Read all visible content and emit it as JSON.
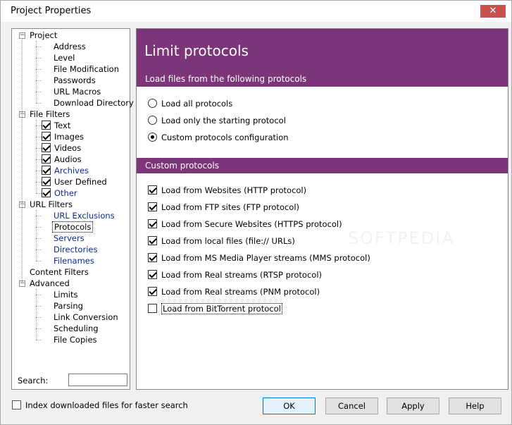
{
  "window": {
    "title": "Project Properties",
    "close_glyph": "✕"
  },
  "tree": {
    "items": [
      {
        "label": "Project",
        "level": 0,
        "expander": "−"
      },
      {
        "label": "Address",
        "level": 1
      },
      {
        "label": "Level",
        "level": 1
      },
      {
        "label": "File Modification",
        "level": 1
      },
      {
        "label": "Passwords",
        "level": 1
      },
      {
        "label": "URL Macros",
        "level": 1
      },
      {
        "label": "Download Directory",
        "level": 1
      },
      {
        "label": "File Filters",
        "level": 0,
        "expander": "−"
      },
      {
        "label": "Text",
        "level": 1,
        "checked": true
      },
      {
        "label": "Images",
        "level": 1,
        "checked": true
      },
      {
        "label": "Videos",
        "level": 1,
        "checked": true
      },
      {
        "label": "Audios",
        "level": 1,
        "checked": true
      },
      {
        "label": "Archives",
        "level": 1,
        "checked": true,
        "link": true
      },
      {
        "label": "User Defined",
        "level": 1,
        "checked": true
      },
      {
        "label": "Other",
        "level": 1,
        "checked": true,
        "link": true
      },
      {
        "label": "URL Filters",
        "level": 0,
        "expander": "−"
      },
      {
        "label": "URL Exclusions",
        "level": 1,
        "link": true
      },
      {
        "label": "Protocols",
        "level": 1,
        "selected": true
      },
      {
        "label": "Servers",
        "level": 1,
        "link": true
      },
      {
        "label": "Directories",
        "level": 1,
        "link": true
      },
      {
        "label": "Filenames",
        "level": 1,
        "link": true
      },
      {
        "label": "Content Filters",
        "level": 0
      },
      {
        "label": "Advanced",
        "level": 0,
        "expander": "−"
      },
      {
        "label": "Limits",
        "level": 1
      },
      {
        "label": "Parsing",
        "level": 1
      },
      {
        "label": "Link Conversion",
        "level": 1
      },
      {
        "label": "Scheduling",
        "level": 1
      },
      {
        "label": "File Copies",
        "level": 1
      }
    ],
    "search_label": "Search:",
    "search_value": ""
  },
  "content": {
    "title": "Limit protocols",
    "section1": "Load files from the following protocols",
    "radios": [
      {
        "label": "Load all protocols",
        "selected": false
      },
      {
        "label": "Load only the starting protocol",
        "selected": false
      },
      {
        "label": "Custom protocols configuration",
        "selected": true
      }
    ],
    "section2": "Custom protocols",
    "checks": [
      {
        "label": "Load from Websites (HTTP protocol)",
        "checked": true
      },
      {
        "label": "Load from FTP sites (FTP protocol)",
        "checked": true
      },
      {
        "label": "Load from Secure Websites (HTTPS protocol)",
        "checked": true
      },
      {
        "label": "Load from local files (file:// URLs)",
        "checked": true
      },
      {
        "label": "Load from MS Media Player streams (MMS protocol)",
        "checked": true
      },
      {
        "label": "Load from Real streams (RTSP protocol)",
        "checked": true
      },
      {
        "label": "Load from Real streams (PNM protocol)",
        "checked": true
      },
      {
        "label": "Load from BitTorrent protocol",
        "checked": false
      }
    ],
    "watermark": "SOFTPEDIA"
  },
  "footer": {
    "index_label": "Index downloaded files for faster search",
    "index_checked": false,
    "ok": "OK",
    "cancel": "Cancel",
    "apply": "Apply",
    "help": "Help"
  },
  "colors": {
    "accent": "#7b3578",
    "link": "#0b2b8a"
  }
}
